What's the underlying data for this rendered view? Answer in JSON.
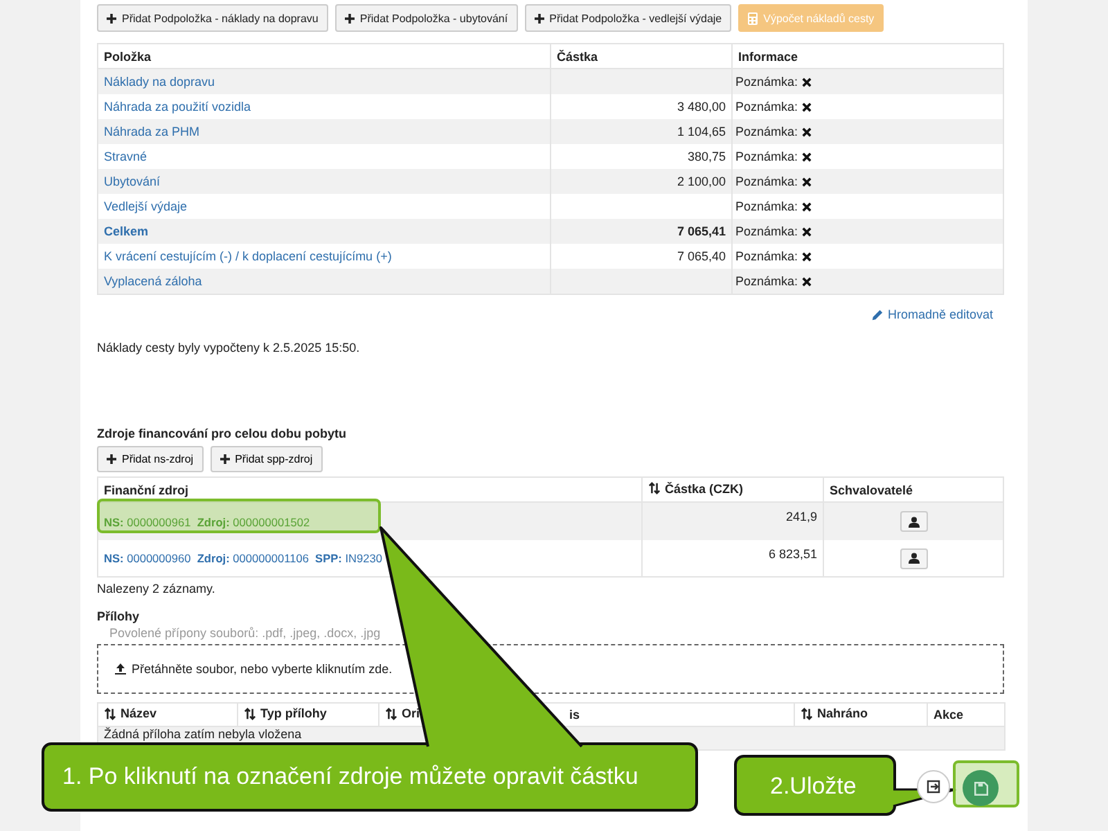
{
  "toolbar": {
    "buttons": [
      {
        "label": "Přidat Podpoložka - náklady na dopravu",
        "kind": "add",
        "disabled": false
      },
      {
        "label": "Přidat Podpoložka - ubytování",
        "kind": "add",
        "disabled": false
      },
      {
        "label": "Přidat Podpoložka - vedlejší výdaje",
        "kind": "add",
        "disabled": false
      },
      {
        "label": "Výpočet nákladů cesty",
        "kind": "calculate",
        "disabled": true
      }
    ]
  },
  "cost_table": {
    "columns": [
      "Položka",
      "Částka",
      "Informace"
    ],
    "rows": [
      {
        "item": "Náklady na dopravu",
        "amount": "",
        "note": "Poznámka:",
        "kind": "item"
      },
      {
        "item": "Náhrada za použití vozidla",
        "amount": "3 480,00",
        "note": "Poznámka:",
        "kind": "item"
      },
      {
        "item": "Náhrada za PHM",
        "amount": "1 104,65",
        "note": "Poznámka:",
        "kind": "item"
      },
      {
        "item": "Stravné",
        "amount": "380,75",
        "note": "Poznámka:",
        "kind": "item"
      },
      {
        "item": "Ubytování",
        "amount": "2 100,00",
        "note": "Poznámka:",
        "kind": "item"
      },
      {
        "item": "Vedlejší výdaje",
        "amount": "",
        "note": "Poznámka:",
        "kind": "item"
      },
      {
        "item": "Celkem",
        "amount": "7 065,41",
        "note": "Poznámka:",
        "kind": "total"
      },
      {
        "item": "K vrácení cestujícím (-) / k doplacení cestujícímu (+)",
        "amount": "7 065,40",
        "note": "Poznámka:",
        "kind": "item"
      },
      {
        "item": "Vyplacená záloha",
        "amount": "",
        "note": "Poznámka:",
        "kind": "item"
      }
    ]
  },
  "bulk_edit_link": "Hromadně editovat",
  "calculation_note": "Náklady cesty byly vypočteny k 2.5.2025 15:50.",
  "funding": {
    "title": "Zdroje financování pro celou dobu pobytu",
    "buttons": [
      "Přidat ns-zdroj",
      "Přidat spp-zdroj"
    ],
    "columns": [
      {
        "label": "Finanční zdroj",
        "sortable": false
      },
      {
        "label": "Částka (CZK)",
        "sortable": true
      },
      {
        "label": "Schvalovatelé",
        "sortable": false
      }
    ],
    "rows": [
      {
        "source": "**NS:** 0000000961  **Zdroj:** 000000001502",
        "amount": "241,9"
      },
      {
        "source": "**NS:** 0000000960  **Zdroj:** 000000001106  **SPP:** IN9230",
        "amount": "6 823,51"
      }
    ],
    "count": "Nalezeny 2 záznamy."
  },
  "attachments": {
    "title": "Přílohy",
    "allowed": "Povolené přípony souborů: .pdf, .jpeg, .docx, .jpg",
    "dropzone": "Přetáhněte soubor, nebo vyberte kliknutím zde.",
    "columns": [
      {
        "label": "Název",
        "sortable": true
      },
      {
        "label": "Typ přílohy",
        "sortable": true
      },
      {
        "label": "Ori",
        "sortable": true
      },
      {
        "label": "is",
        "sortable": false
      },
      {
        "label": "Nahráno",
        "sortable": true
      },
      {
        "label": "Akce",
        "sortable": false
      }
    ],
    "empty": "Žádná příloha zatím nebyla vložena"
  },
  "callouts": [
    {
      "text": "1. Po kliknutí na označení zdroje můžete opravit částku"
    },
    {
      "text": "2.Uložte"
    }
  ]
}
